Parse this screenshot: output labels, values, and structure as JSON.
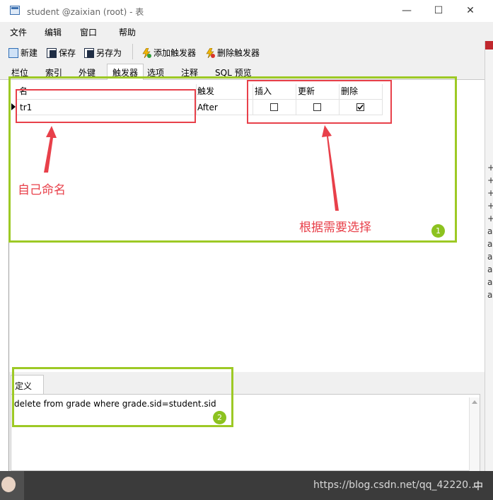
{
  "window": {
    "title": "student @zaixian (root) - 表",
    "minimize_glyph": "—",
    "maximize_glyph": "☐",
    "close_glyph": "✕"
  },
  "menu": {
    "items": [
      "文件",
      "编辑",
      "窗口",
      "帮助"
    ]
  },
  "toolbar": {
    "new_label": "新建",
    "save_label": "保存",
    "save_as_label": "另存为",
    "add_trigger_label": "添加触发器",
    "delete_trigger_label": "删除触发器"
  },
  "tabs": [
    "栏位",
    "索引",
    "外键",
    "触发器",
    "选项",
    "注释",
    "SQL 预览"
  ],
  "active_tab": "触发器",
  "grid": {
    "columns": {
      "name": "名",
      "fires": "触发",
      "insert": "插入",
      "update": "更新",
      "delete": "删除"
    },
    "rows": [
      {
        "name": "tr1",
        "fires": "After",
        "insert": false,
        "update": false,
        "delete": true
      }
    ]
  },
  "annotations": {
    "name_hint": "自己命名",
    "select_hint": "根据需要选择",
    "badge_1": "1",
    "badge_2": "2"
  },
  "definition": {
    "tab_label": "定义",
    "sql": "delete from grade where grade.sid=student.sid"
  },
  "background_glyphs": [
    "+",
    "+",
    "+",
    "+",
    "+",
    "a",
    "a",
    "a",
    "a",
    "a",
    "a"
  ],
  "taskbar": {
    "tray_text": "https://blog.csdn.net/qq_42220...",
    "ime_label": "中"
  },
  "colors": {
    "annotation_red": "#e8404a",
    "annotation_green": "#9dc925"
  }
}
